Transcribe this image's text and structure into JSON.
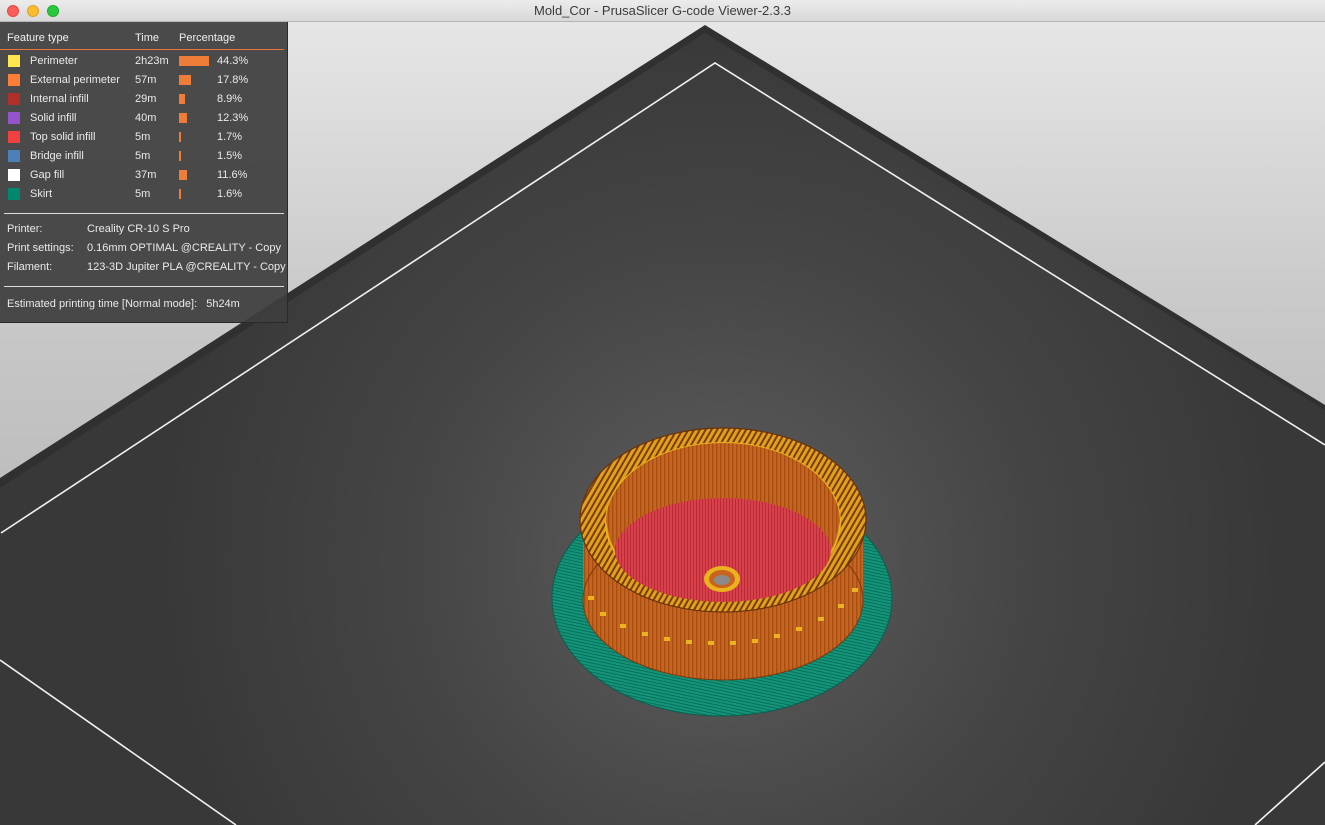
{
  "window": {
    "title": "Mold_Cor - PrusaSlicer G-code Viewer-2.3.3"
  },
  "legend": {
    "headers": {
      "feature_type": "Feature type",
      "time": "Time",
      "percentage": "Percentage"
    },
    "features": [
      {
        "name": "Perimeter",
        "time": "2h23m",
        "percent_label": "44.3%",
        "percent": 44.3,
        "color": "#ffe64d"
      },
      {
        "name": "External perimeter",
        "time": "57m",
        "percent_label": "17.8%",
        "percent": 17.8,
        "color": "#ff7d38"
      },
      {
        "name": "Internal infill",
        "time": "29m",
        "percent_label": "8.9%",
        "percent": 8.9,
        "color": "#b03029"
      },
      {
        "name": "Solid infill",
        "time": "40m",
        "percent_label": "12.3%",
        "percent": 12.3,
        "color": "#9654cc"
      },
      {
        "name": "Top solid infill",
        "time": "5m",
        "percent_label": "1.7%",
        "percent": 1.7,
        "color": "#f04040"
      },
      {
        "name": "Bridge infill",
        "time": "5m",
        "percent_label": "1.5%",
        "percent": 1.5,
        "color": "#4d80ba"
      },
      {
        "name": "Gap fill",
        "time": "37m",
        "percent_label": "11.6%",
        "percent": 11.6,
        "color": "#ffffff"
      },
      {
        "name": "Skirt",
        "time": "5m",
        "percent_label": "1.6%",
        "percent": 1.6,
        "color": "#00876e"
      }
    ],
    "info": {
      "printer_label": "Printer:",
      "printer_value": "Creality CR-10 S Pro",
      "print_settings_label": "Print settings:",
      "print_settings_value": "0.16mm OPTIMAL @CREALITY - Copy",
      "filament_label": "Filament:",
      "filament_value": "123-3D Jupiter PLA @CREALITY - Copy"
    },
    "estimate": {
      "label": "Estimated printing time [Normal mode]:",
      "value": "5h24m"
    }
  },
  "colors": {
    "bar": "#f07c3a",
    "bed": "#3f3f3f",
    "bed_frame": "#333333",
    "print_body": "#c8641e",
    "skirt": "#12957a",
    "infill": "#d9404a"
  }
}
